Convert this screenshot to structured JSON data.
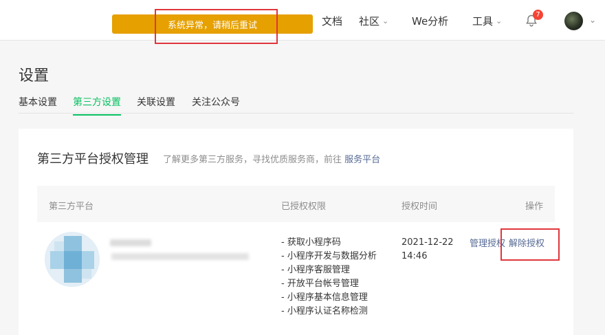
{
  "topbar": {
    "nav": [
      {
        "label": "文档",
        "dropdown": false
      },
      {
        "label": "社区",
        "dropdown": true
      },
      {
        "label": "We分析",
        "dropdown": false
      },
      {
        "label": "工具",
        "dropdown": true
      }
    ],
    "notification_count": "7",
    "toast": "系统异常，请稍后重试"
  },
  "page": {
    "title": "设置",
    "tabs": [
      {
        "label": "基本设置",
        "active": false
      },
      {
        "label": "第三方设置",
        "active": true
      },
      {
        "label": "关联设置",
        "active": false
      },
      {
        "label": "关注公众号",
        "active": false
      }
    ]
  },
  "card": {
    "title": "第三方平台授权管理",
    "desc_prefix": "了解更多第三方服务，寻找优质服务商，前往",
    "desc_link": "服务平台",
    "table": {
      "headers": [
        "第三方平台",
        "已授权权限",
        "授权时间",
        "操作"
      ],
      "rows": [
        {
          "permissions": [
            "- 获取小程序码",
            "- 小程序开发与数据分析",
            "- 小程序客服管理",
            "- 开放平台帐号管理",
            "- 小程序基本信息管理",
            "- 小程序认证名称检测"
          ],
          "time": "2021-12-22 14:46",
          "manage_label": "管理授权",
          "revoke_label": "解除授权"
        }
      ]
    }
  },
  "colors": {
    "accent": "#07c160",
    "link": "#576b95",
    "toast": "#e6a000",
    "badge": "#f54335",
    "highlight_box": "#e0353b"
  }
}
